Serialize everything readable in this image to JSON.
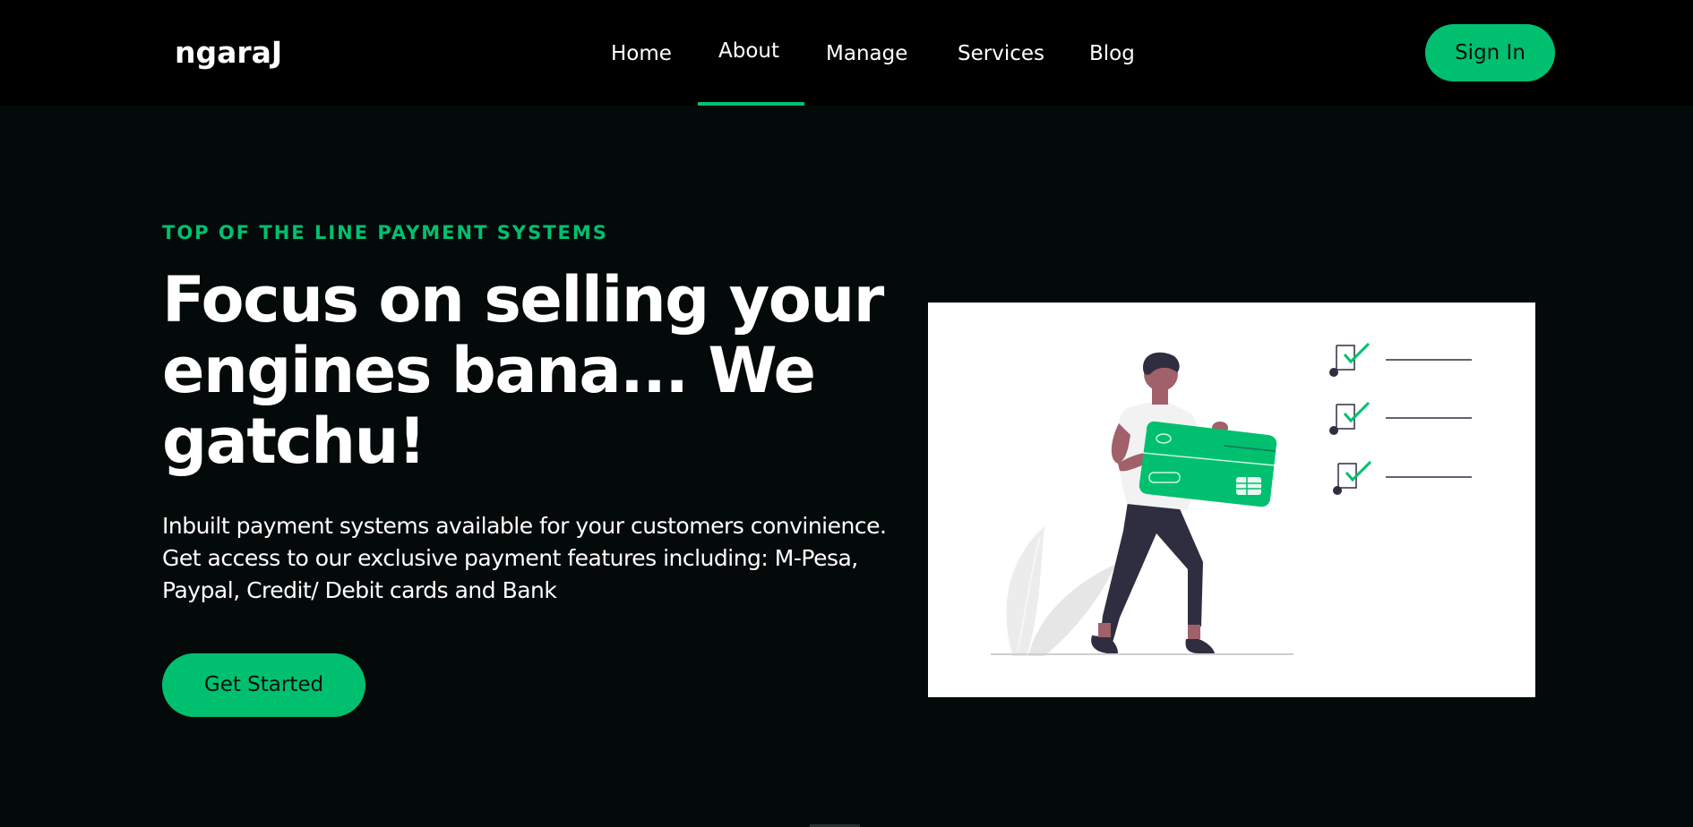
{
  "brand": {
    "name": "ngaraJ"
  },
  "nav": {
    "items": [
      {
        "label": "Home",
        "active": false
      },
      {
        "label": "About",
        "active": true
      },
      {
        "label": "Manage",
        "active": false
      },
      {
        "label": "Services",
        "active": false
      },
      {
        "label": "Blog",
        "active": false
      }
    ],
    "signin_label": "Sign In"
  },
  "hero": {
    "eyebrow": "TOP OF THE LINE PAYMENT SYSTEMS",
    "headline": "Focus on selling your engines bana... We gatchu!",
    "description": "Inbuilt payment systems available for your customers convinience. Get access to our exclusive payment features including: M-Pesa, Paypal, Credit/ Debit cards and Bank",
    "cta_label": "Get Started"
  },
  "colors": {
    "accent": "#00c070",
    "background": "#04090a",
    "navbar": "#000000",
    "text": "#ffffff"
  },
  "icons": {
    "illustration": "person-holding-credit-card-illustration",
    "checklist": "checkbox-checked-icon"
  }
}
